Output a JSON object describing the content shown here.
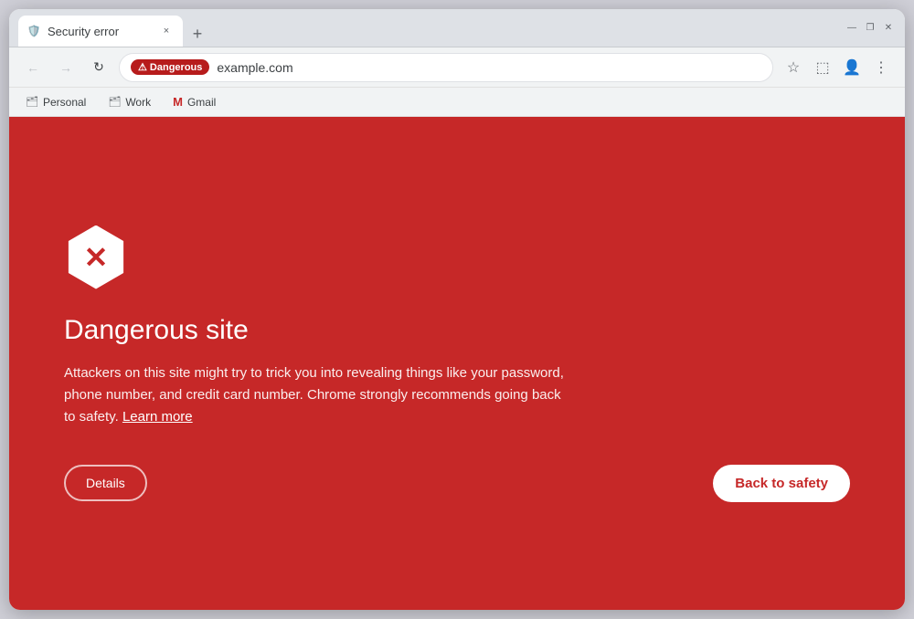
{
  "browser": {
    "tab": {
      "title": "Security error",
      "close_label": "×"
    },
    "new_tab_label": "+",
    "window_controls": {
      "minimize": "—",
      "maximize": "❐",
      "close": "✕"
    },
    "nav": {
      "back_label": "←",
      "forward_label": "→",
      "reload_label": "↻",
      "dangerous_badge": "⚠ Dangerous",
      "url": "example.com",
      "star_label": "☆",
      "extensions_label": "⬚",
      "profile_label": "👤",
      "menu_label": "⋮"
    },
    "bookmarks": [
      {
        "label": "Personal",
        "icon": "🗂"
      },
      {
        "label": "Work",
        "icon": "🗂"
      },
      {
        "label": "Gmail",
        "icon": "M"
      }
    ]
  },
  "page": {
    "icon_label": "✕",
    "heading": "Dangerous site",
    "body": "Attackers on this site might try to trick you into revealing things like your password, phone number, and credit card number. Chrome strongly recommends going back to safety.",
    "learn_more": "Learn more",
    "details_button": "Details",
    "back_to_safety_button": "Back to safety"
  }
}
